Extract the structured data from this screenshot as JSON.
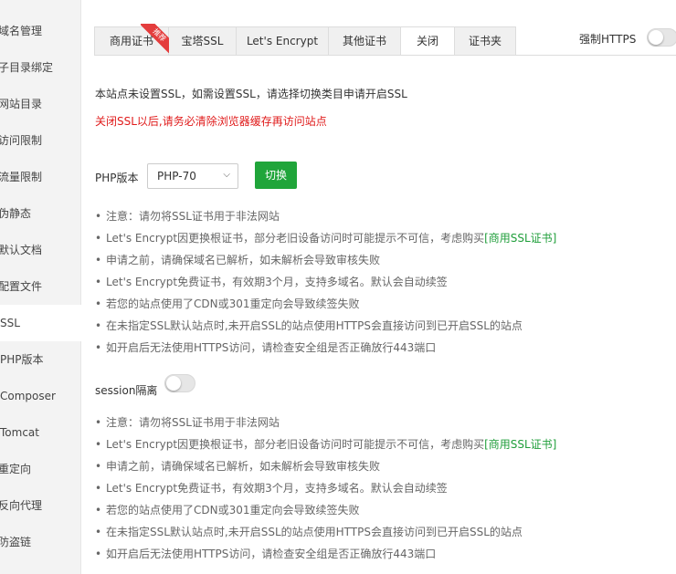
{
  "sidebar": {
    "items": [
      {
        "label": "域名管理"
      },
      {
        "label": "子目录绑定"
      },
      {
        "label": "网站目录"
      },
      {
        "label": "访问限制"
      },
      {
        "label": "流量限制"
      },
      {
        "label": "伪静态"
      },
      {
        "label": "默认文档"
      },
      {
        "label": "配置文件"
      },
      {
        "label": "SSL"
      },
      {
        "label": "PHP版本"
      },
      {
        "label": "Composer"
      },
      {
        "label": "Tomcat"
      },
      {
        "label": "重定向"
      },
      {
        "label": "反向代理"
      },
      {
        "label": "防盗链"
      }
    ]
  },
  "tabs": [
    {
      "label": "商用证书",
      "badge": "推荐"
    },
    {
      "label": "宝塔SSL"
    },
    {
      "label": "Let's Encrypt"
    },
    {
      "label": "其他证书"
    },
    {
      "label": "关闭"
    },
    {
      "label": "证书夹"
    }
  ],
  "force_https": {
    "label": "强制HTTPS",
    "enabled": false
  },
  "notice": {
    "line1": "本站点未设置SSL，如需设置SSL，请选择切换类目申请开启SSL",
    "line2": "关闭SSL以后,请务必清除浏览器缓存再访问站点"
  },
  "php": {
    "label": "PHP版本",
    "selected": "PHP-70",
    "switch_label": "切换"
  },
  "tips": [
    {
      "text": "注意：请勿将SSL证书用于非法网站",
      "style": "red"
    },
    {
      "text": "Let's Encrypt因更换根证书，部分老旧设备访问时可能提示不可信，考虑购买",
      "link": "[商用SSL证书]",
      "style": "red"
    },
    {
      "text": "申请之前，请确保域名已解析，如未解析会导致审核失败",
      "style": "gray"
    },
    {
      "text": "Let's Encrypt免费证书，有效期3个月，支持多域名。默认会自动续签",
      "style": "gray"
    },
    {
      "text": "若您的站点使用了CDN或301重定向会导致续签失败",
      "style": "gray"
    },
    {
      "text": "在未指定SSL默认站点时,未开启SSL的站点使用HTTPS会直接访问到已开启SSL的站点",
      "style": "gray"
    },
    {
      "text": "如开启后无法使用HTTPS访问，请检查安全组是否正确放行443端口",
      "style": "gray"
    }
  ],
  "session": {
    "label": "session隔离",
    "enabled": false
  },
  "colors": {
    "accent": "#20a53a",
    "warning": "#e01b1b",
    "link": "#1f9e3a"
  }
}
